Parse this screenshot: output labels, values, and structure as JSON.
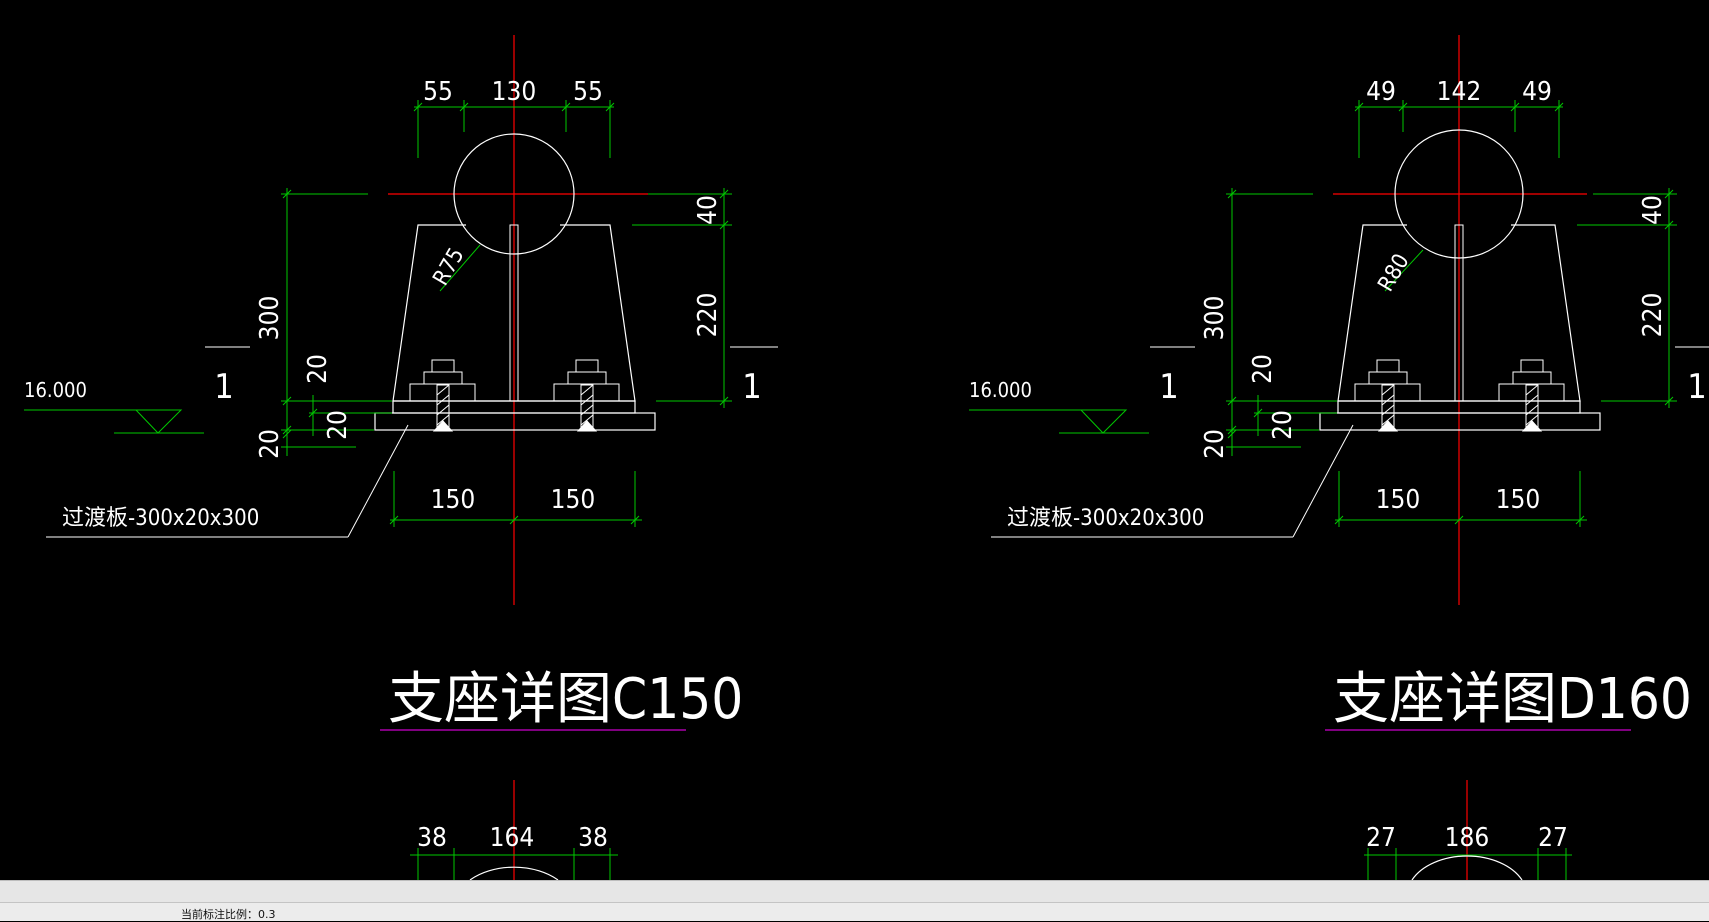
{
  "window": {
    "background": "#000000"
  },
  "colors": {
    "outline": "#ffffff",
    "dimension": "#00c800",
    "centerline": "#ff0000",
    "title_underline": "#cc00cc"
  },
  "status_bar": {
    "text": "当前标注比例：0.3"
  },
  "details": [
    {
      "title": "支座详图C150",
      "top_dims": [
        "55",
        "130",
        "55"
      ],
      "radius": "R75",
      "height_total": "300",
      "height_upper": "220",
      "top_offset": "40",
      "left_20a": "20",
      "left_20b": "20",
      "left_20c": "20",
      "bottom_left": "150",
      "bottom_right": "150",
      "elevation": "16.000",
      "section_mark": "1",
      "transition_plate": "过渡板-300x20x300"
    },
    {
      "title": "支座详图D160",
      "top_dims": [
        "49",
        "142",
        "49"
      ],
      "radius": "R80",
      "height_total": "300",
      "height_upper": "220",
      "top_offset": "40",
      "left_20a": "20",
      "left_20b": "20",
      "left_20c": "20",
      "bottom_left": "150",
      "bottom_right": "150",
      "elevation": "16.000",
      "section_mark": "1",
      "transition_plate": "过渡板-300x20x300"
    }
  ],
  "partial_details": [
    {
      "top_dims": [
        "38",
        "164",
        "38"
      ]
    },
    {
      "top_dims": [
        "27",
        "186",
        "27"
      ]
    }
  ]
}
